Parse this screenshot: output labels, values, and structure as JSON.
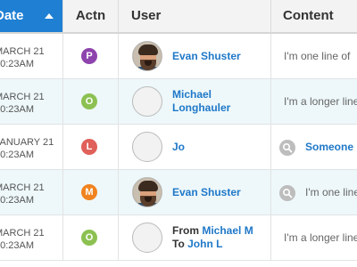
{
  "columns": {
    "date": "Date",
    "actn": "Actn",
    "user": "User",
    "content": "Content"
  },
  "colors": {
    "accent": "#1f7fd3",
    "link": "#1f78c8",
    "row_alt": "#eef8fa"
  },
  "rows": [
    {
      "date_line1": "MARCH 21",
      "date_line2": "10:23AM",
      "action": "P",
      "action_color": "#8e44ad",
      "user_name": "Evan Shuster",
      "content": "I'm one line of"
    },
    {
      "date_line1": "MARCH 21",
      "date_line2": "10:23AM",
      "action": "O",
      "action_color": "#8cc152",
      "user_line1": "Michael",
      "user_line2": "Longhauler",
      "content": "I'm a longer line"
    },
    {
      "date_line1": "JANUARY 21",
      "date_line2": "10:23AM",
      "action": "L",
      "action_color": "#e0605a",
      "user_name": "Jo",
      "content": "Someone"
    },
    {
      "date_line1": "MARCH 21",
      "date_line2": "10:23AM",
      "action": "M",
      "action_color": "#f0831f",
      "user_name": "Evan Shuster",
      "content": "I'm one line"
    },
    {
      "date_line1": "MARCH 21",
      "date_line2": "10:23AM",
      "action": "O",
      "action_color": "#8cc152",
      "from_label": "From",
      "from_name": "Michael M",
      "to_label": "To",
      "to_name": "John L",
      "content": "I'm a longer line"
    }
  ]
}
